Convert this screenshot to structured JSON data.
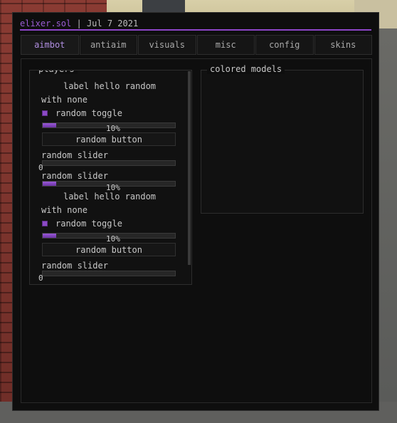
{
  "window": {
    "brand": "elixer.sol",
    "separator": " | ",
    "date": "Jul 7 2021"
  },
  "tabs": [
    {
      "label": "aimbot",
      "active": true
    },
    {
      "label": "antiaim"
    },
    {
      "label": "visuals"
    },
    {
      "label": "misc"
    },
    {
      "label": "config"
    },
    {
      "label": "skins"
    }
  ],
  "groups": {
    "players": {
      "title": "players",
      "items": [
        {
          "label": "label hello random"
        },
        {
          "label": "with none"
        },
        {
          "label": "random toggle",
          "checked": true
        },
        {
          "progress": 0.1,
          "display": "10%"
        },
        {
          "label": "random button"
        },
        {
          "label": "random slider",
          "value": 0,
          "display": "0"
        },
        {
          "label": "random slider",
          "value": 0.1,
          "display": "10%"
        },
        {
          "label": "label hello random"
        },
        {
          "label": "with none"
        },
        {
          "label": "random toggle",
          "checked": true
        },
        {
          "progress": 0.1,
          "display": "10%"
        },
        {
          "label": "random button"
        },
        {
          "label": "random slider",
          "value": 0,
          "display": "0"
        }
      ]
    },
    "colored_models": {
      "title": "colored models"
    }
  },
  "colors": {
    "accent": "#8d45c8",
    "background": "#0e0e0e"
  }
}
